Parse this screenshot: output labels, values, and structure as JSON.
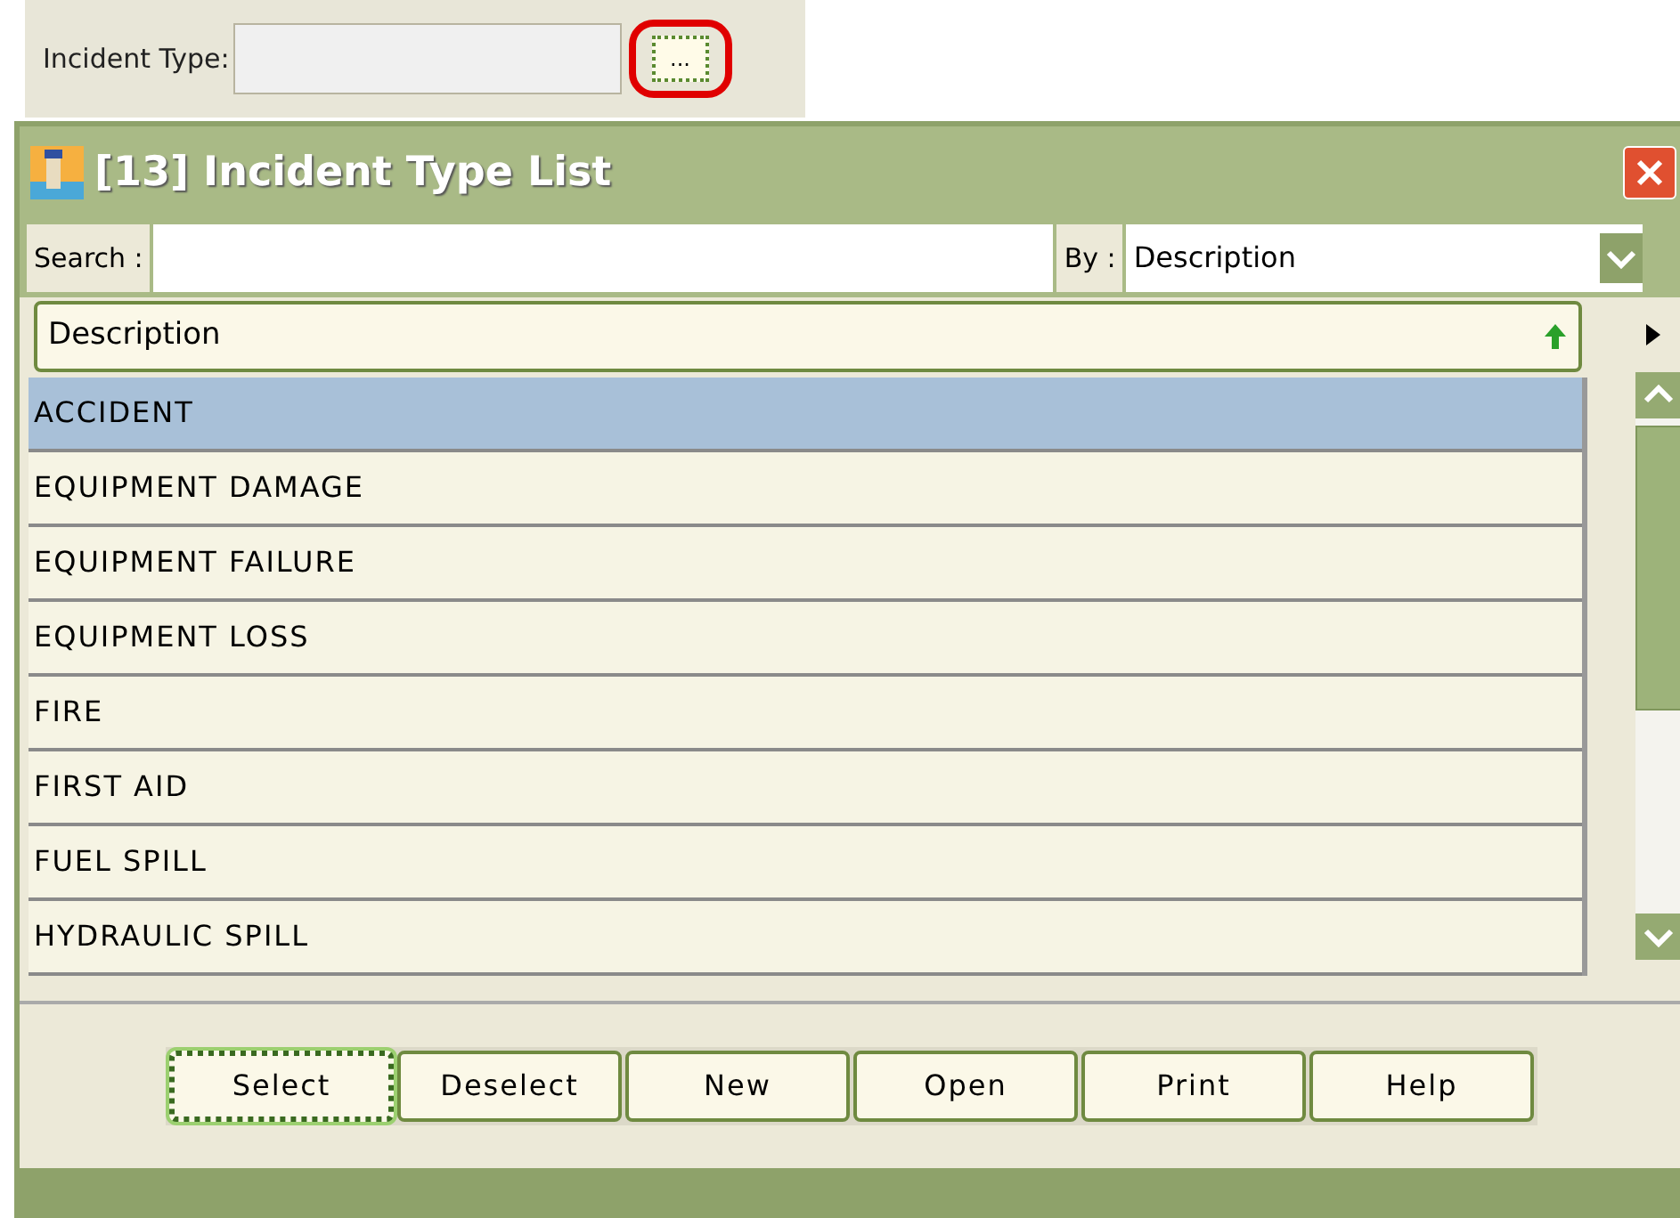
{
  "field": {
    "label": "Incident Type:",
    "button": "..."
  },
  "window": {
    "title": "[13] Incident Type List"
  },
  "search": {
    "label": "Search :",
    "by_label": "By :",
    "by_value": "Description"
  },
  "table": {
    "column": "Description",
    "rows": [
      {
        "text": "ACCIDENT",
        "selected": true
      },
      {
        "text": "EQUIPMENT DAMAGE",
        "selected": false
      },
      {
        "text": "EQUIPMENT FAILURE",
        "selected": false
      },
      {
        "text": "EQUIPMENT LOSS",
        "selected": false
      },
      {
        "text": "FIRE",
        "selected": false
      },
      {
        "text": "FIRST AID",
        "selected": false
      },
      {
        "text": "FUEL SPILL",
        "selected": false
      },
      {
        "text": "HYDRAULIC SPILL",
        "selected": false
      }
    ]
  },
  "buttons": [
    {
      "label": "Select",
      "selected": true
    },
    {
      "label": "Deselect",
      "selected": false
    },
    {
      "label": "New",
      "selected": false
    },
    {
      "label": "Open",
      "selected": false
    },
    {
      "label": "Print",
      "selected": false
    },
    {
      "label": "Help",
      "selected": false
    }
  ]
}
